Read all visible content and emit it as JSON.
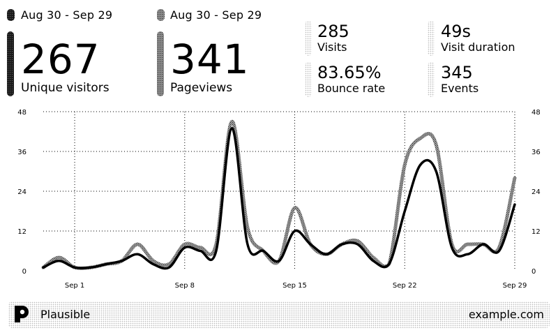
{
  "header": {
    "primary_range": "Aug 30 - Sep 29",
    "secondary_range": "Aug 30 - Sep 29"
  },
  "stats": {
    "unique_visitors": {
      "value": "267",
      "label": "Unique visitors"
    },
    "pageviews": {
      "value": "341",
      "label": "Pageviews"
    },
    "visits": {
      "value": "285",
      "label": "Visits"
    },
    "visit_duration": {
      "value": "49s",
      "label": "Visit duration"
    },
    "bounce_rate": {
      "value": "83.65%",
      "label": "Bounce rate"
    },
    "events": {
      "value": "345",
      "label": "Events"
    }
  },
  "footer": {
    "brand": "Plausible",
    "site": "example.com"
  },
  "chart_data": {
    "type": "line",
    "x": [
      "Aug 30",
      "Aug 31",
      "Sep 1",
      "Sep 2",
      "Sep 3",
      "Sep 4",
      "Sep 5",
      "Sep 6",
      "Sep 7",
      "Sep 8",
      "Sep 9",
      "Sep 10",
      "Sep 11",
      "Sep 12",
      "Sep 13",
      "Sep 14",
      "Sep 15",
      "Sep 16",
      "Sep 17",
      "Sep 18",
      "Sep 19",
      "Sep 20",
      "Sep 21",
      "Sep 22",
      "Sep 23",
      "Sep 24",
      "Sep 25",
      "Sep 26",
      "Sep 27",
      "Sep 28",
      "Sep 29"
    ],
    "x_tick_labels": [
      "Sep 1",
      "Sep 8",
      "Sep 15",
      "Sep 22",
      "Sep 29"
    ],
    "y_ticks": [
      0,
      12,
      24,
      36,
      48
    ],
    "ylim": [
      0,
      48
    ],
    "grid": true,
    "series": [
      {
        "name": "Pageviews",
        "values": [
          1,
          4,
          1,
          1,
          2,
          3,
          8,
          3,
          2,
          8,
          7,
          8,
          45,
          13,
          6,
          3,
          19,
          8,
          5,
          8,
          9,
          4,
          2,
          32,
          40,
          38,
          8,
          8,
          8,
          7,
          28
        ]
      },
      {
        "name": "Unique visitors",
        "values": [
          1,
          3,
          1,
          1,
          2,
          3,
          5,
          2,
          1,
          7,
          6,
          6,
          43,
          8,
          6,
          3,
          12,
          8,
          5,
          8,
          8,
          3,
          2,
          18,
          32,
          30,
          7,
          5,
          8,
          6,
          20
        ]
      }
    ]
  }
}
